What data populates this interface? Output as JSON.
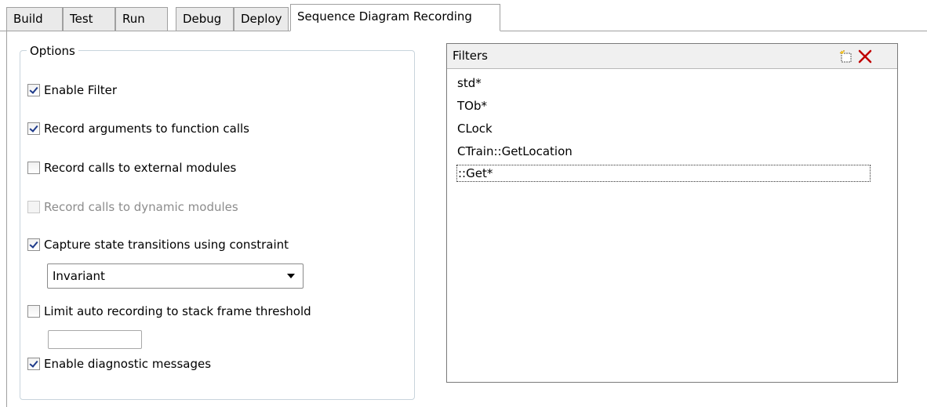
{
  "tabs": [
    {
      "label": "Build",
      "active": false
    },
    {
      "label": "Test",
      "active": false
    },
    {
      "label": "Run",
      "active": false
    },
    {
      "label": "Debug",
      "active": false
    },
    {
      "label": "Deploy",
      "active": false
    },
    {
      "label": "Sequence Diagram Recording",
      "active": true
    }
  ],
  "options": {
    "title": "Options",
    "items": [
      {
        "label": "Enable Filter",
        "checked": true,
        "enabled": true
      },
      {
        "label": "Record arguments to function calls",
        "checked": true,
        "enabled": true
      },
      {
        "label": "Record calls to external modules",
        "checked": false,
        "enabled": true
      },
      {
        "label": "Record calls to dynamic modules",
        "checked": false,
        "enabled": false
      },
      {
        "label": "Capture state transitions using constraint",
        "checked": true,
        "enabled": true
      },
      {
        "label": "Limit auto recording to stack frame threshold",
        "checked": false,
        "enabled": true
      },
      {
        "label": "Enable diagnostic messages",
        "checked": true,
        "enabled": true
      }
    ],
    "constraint_select": {
      "value": "Invariant"
    },
    "threshold_value": ""
  },
  "filters": {
    "title": "Filters",
    "new_icon": "new-item-icon",
    "delete_icon": "delete-x-icon",
    "delete_color": "#c00000",
    "items": [
      "std*",
      "TOb*",
      "CLock",
      "CTrain::GetLocation",
      "::Get*"
    ],
    "focused_index": 4
  }
}
